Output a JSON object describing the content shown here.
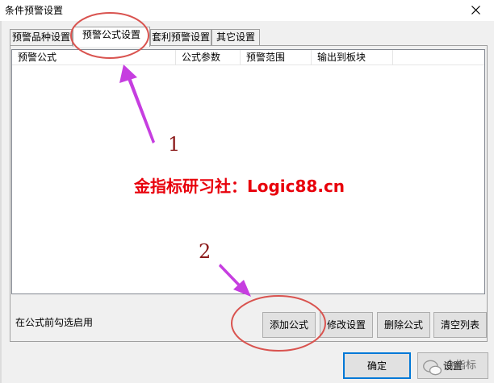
{
  "window": {
    "title": "条件预警设置"
  },
  "tabs": [
    {
      "label": "预警品种设置"
    },
    {
      "label": "预警公式设置"
    },
    {
      "label": "套利预警设置"
    },
    {
      "label": "其它设置"
    }
  ],
  "list": {
    "columns": [
      "预警公式",
      "公式参数",
      "预警范围",
      "输出到板块"
    ],
    "rows": []
  },
  "hint": "在公式前勾选启用",
  "buttons": {
    "add_formula": "添加公式",
    "modify": "修改设置",
    "delete_formula": "删除公式",
    "clear_list": "清空列表",
    "ok": "确定",
    "settings": "设置"
  },
  "annotation": {
    "watermark": "金指标研习社：Logic88.cn",
    "step1": "1",
    "step2": "2",
    "logo_text": "金指标",
    "color_circle": "#d9534f",
    "color_arrow": "#c63ee0",
    "color_text": "#e8000b"
  }
}
